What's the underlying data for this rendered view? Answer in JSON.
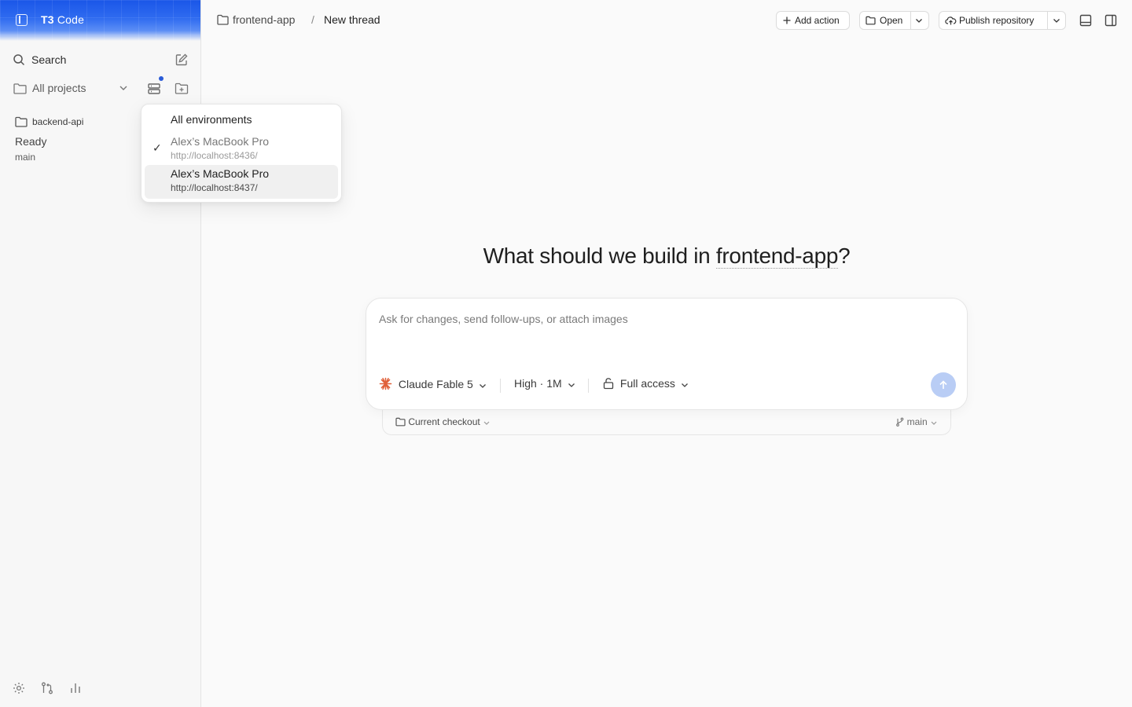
{
  "app": {
    "name_bold": "T3",
    "name_rest": " Code"
  },
  "sidebar": {
    "search_label": "Search",
    "projects_filter": "All projects",
    "project": {
      "name": "backend-api",
      "status": "Ready",
      "branch": "main"
    }
  },
  "env_menu": {
    "header": "All environments",
    "items": [
      {
        "title": "Alex’s MacBook Pro",
        "url": "http://localhost:8436/",
        "selected": true
      },
      {
        "title": "Alex’s MacBook Pro",
        "url": "http://localhost:8437/",
        "selected": false
      }
    ],
    "check": "✓"
  },
  "header": {
    "project": "frontend-app",
    "separator": "/",
    "thread": "New thread",
    "add_action": "Add action",
    "open": "Open",
    "publish": "Publish repository"
  },
  "main": {
    "headline_prefix": "What should we build in ",
    "headline_project": "frontend-app",
    "headline_suffix": "?",
    "composer": {
      "placeholder": "Ask for changes, send follow-ups, or attach images",
      "value": "",
      "model": "Claude Fable 5",
      "effort": "High · 1M",
      "access": "Full access"
    },
    "checkout": "Current checkout",
    "branch": "main"
  },
  "colors": {
    "accent": "#2a5bd7",
    "send_button": "#b9cdf5",
    "model_icon": "#e0603a"
  }
}
